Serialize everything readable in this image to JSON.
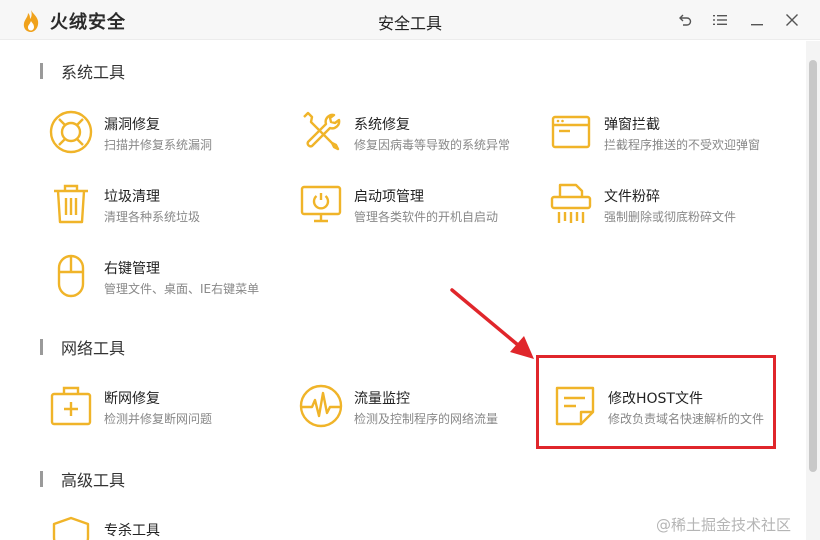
{
  "app": {
    "brand": "火绒安全",
    "window_title": "安全工具"
  },
  "colors": {
    "accent_icon": "#f0b429",
    "highlight_border": "#e0262b",
    "arrow": "#e0262b"
  },
  "sections": [
    {
      "title": "系统工具",
      "tools": [
        {
          "name": "漏洞修复",
          "desc": "扫描并修复系统漏洞",
          "icon": "lifebuoy-icon"
        },
        {
          "name": "系统修复",
          "desc": "修复因病毒等导致的系统异常",
          "icon": "wrench-screwdriver-icon"
        },
        {
          "name": "弹窗拦截",
          "desc": "拦截程序推送的不受欢迎弹窗",
          "icon": "popup-window-icon"
        },
        {
          "name": "垃圾清理",
          "desc": "清理各种系统垃圾",
          "icon": "trash-icon"
        },
        {
          "name": "启动项管理",
          "desc": "管理各类软件的开机自启动",
          "icon": "monitor-power-icon"
        },
        {
          "name": "文件粉碎",
          "desc": "强制删除或彻底粉碎文件",
          "icon": "shredder-icon"
        },
        {
          "name": "右键管理",
          "desc": "管理文件、桌面、IE右键菜单",
          "icon": "mouse-icon"
        }
      ]
    },
    {
      "title": "网络工具",
      "tools": [
        {
          "name": "断网修复",
          "desc": "检测并修复断网问题",
          "icon": "first-aid-kit-icon"
        },
        {
          "name": "流量监控",
          "desc": "检测及控制程序的网络流量",
          "icon": "traffic-pulse-icon"
        },
        {
          "name": "修改HOST文件",
          "desc": "修改负责域名快速解析的文件",
          "icon": "note-file-icon"
        }
      ]
    },
    {
      "title": "高级工具",
      "tools": [
        {
          "name": "专杀工具",
          "desc": "",
          "icon": "shield-icon"
        }
      ]
    }
  ],
  "watermark": "@稀土掘金技术社区"
}
